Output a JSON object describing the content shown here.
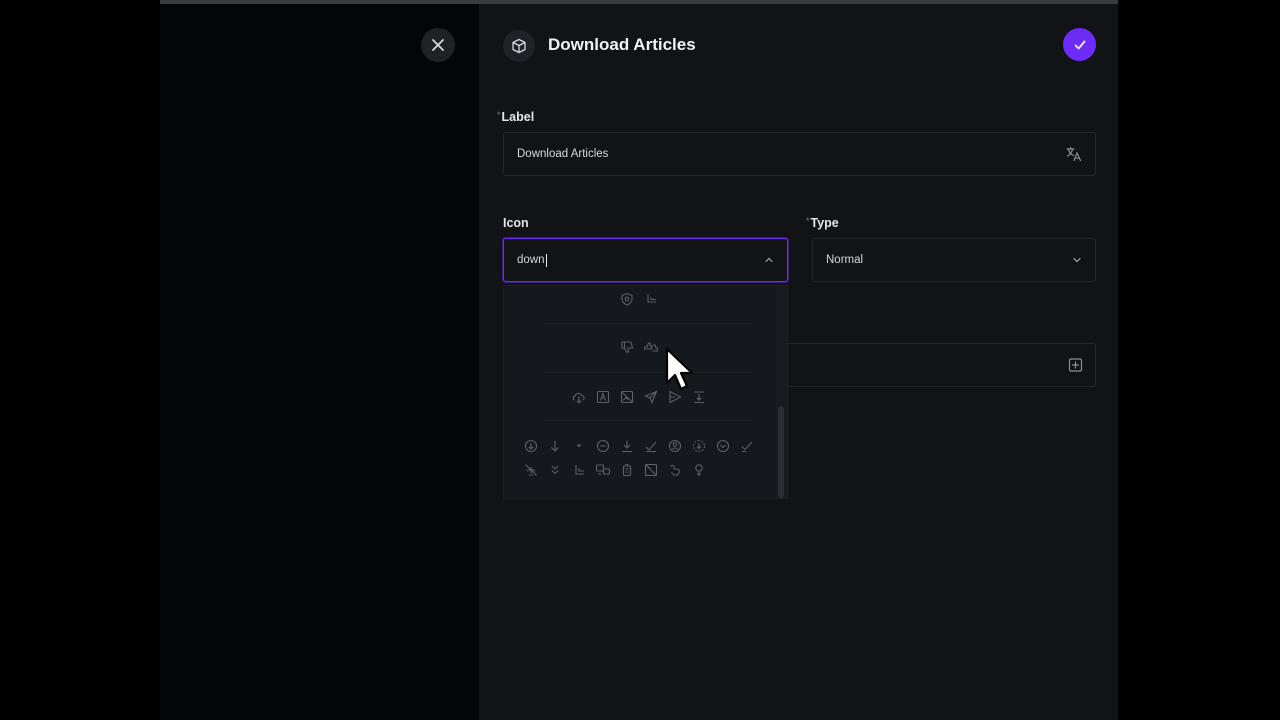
{
  "modal": {
    "title": "Download Articles",
    "close_icon": "close-icon",
    "header_icon": "cube-icon",
    "confirm_icon": "check-icon",
    "accent_color": "#6c2cf5"
  },
  "label_field": {
    "label": "Label",
    "required": "*",
    "value": "Download Articles",
    "suffix_icon": "translate-icon"
  },
  "icon_field": {
    "label": "Icon",
    "value": "down",
    "suffix_icon": "chevron-up-icon",
    "options_icons": [
      "shield-icon",
      "corner-down-left-icon",
      "thumb-down-icon",
      "thumbs-updown-icon",
      "cloud-download-icon",
      "letter-a-icon",
      "image-off-icon",
      "send-icon",
      "send-off-icon",
      "align-bottom-icon",
      "circle-arrow-down-icon",
      "arrow-down-icon",
      "caret-down-icon",
      "circle-chevron-down-icon",
      "download-icon",
      "check-icon",
      "user-circle-icon",
      "circle-dashed-download-icon",
      "circle-check-down-icon",
      "check-icon",
      "wifi-off-icon",
      "chevrons-down-icon",
      "corner-left-down-icon",
      "switch-icon",
      "battery-down-icon",
      "photo-down-icon",
      "hand-down-icon",
      "female-icon"
    ]
  },
  "type_field": {
    "label": "Type",
    "required": "*",
    "value": "Normal",
    "suffix_icon": "chevron-down-icon"
  },
  "hidden_field": {
    "suffix_icon": "add-square-icon"
  }
}
